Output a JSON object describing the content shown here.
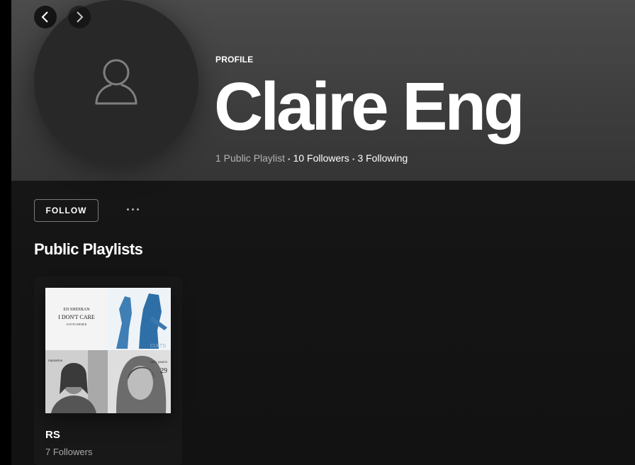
{
  "nav": {
    "back_icon": "chevron-left-icon",
    "forward_icon": "chevron-right-icon"
  },
  "profile": {
    "label": "PROFILE",
    "name": "Claire Eng",
    "avatar_icon": "user-icon",
    "stats": {
      "playlists": "1 Public Playlist",
      "followers": "10 Followers",
      "following": "3 Following",
      "separator": "•"
    }
  },
  "actions": {
    "follow_label": "FOLLOW",
    "more_icon": "more-options-icon"
  },
  "section": {
    "title": "Public Playlists"
  },
  "playlists": [
    {
      "title": "RS",
      "subtitle": "7 Followers",
      "cover_texts": {
        "tl_artist": "ED SHEERAN",
        "tl_title": "I DON'T CARE",
        "tl_feat": "JUSTIN BIEBER",
        "tr_word": "CULTS",
        "bl_word": "reputation",
        "br_name": "carly pearce",
        "br_num": "29"
      }
    }
  ],
  "colors": {
    "header_gradient_top": "#4b4b4b",
    "background": "#121212",
    "card": "#181818",
    "muted_text": "#b3b3b3"
  }
}
